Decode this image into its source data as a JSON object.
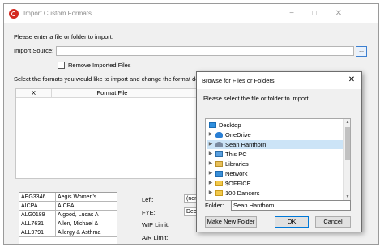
{
  "main": {
    "title": "Import Custom Formats",
    "minimize": "−",
    "maximize": "□",
    "close": "✕",
    "instruction": "Please enter a file or folder to import.",
    "source_label": "Import Source:",
    "browse_label": "...",
    "remove_label": "Remove Imported Files",
    "select_text": "Select the formats you would like to import and change the format descri",
    "table_headers": [
      "X",
      "Format File"
    ]
  },
  "clients": [
    {
      "code": "AEG3346",
      "name": "Aegis Women's"
    },
    {
      "code": "AICPA",
      "name": "AICPA"
    },
    {
      "code": "ALG0189",
      "name": "Algood, Lucas A"
    },
    {
      "code": "ALL7631",
      "name": "Allen, Michael &"
    },
    {
      "code": "ALL9791",
      "name": "Allergy & Asthma"
    }
  ],
  "fields": [
    {
      "label": "Left:",
      "value": "(non"
    },
    {
      "label": "FYE:",
      "value": "Dece"
    },
    {
      "label": "WIP Limit:",
      "value": ""
    },
    {
      "label": "A/R Limit:",
      "value": ""
    }
  ],
  "dialog": {
    "title": "Browse for Files or Folders",
    "close": "✕",
    "instruction": "Please select the file or folder to import.",
    "tree": [
      {
        "label": "Desktop",
        "icon": "desktop-icon",
        "expand": false,
        "indent": 0
      },
      {
        "label": "OneDrive",
        "icon": "onedrive-icon",
        "expand": true,
        "indent": 1
      },
      {
        "label": "Sean Hanthorn",
        "icon": "user-icon",
        "expand": true,
        "indent": 1,
        "selected": true
      },
      {
        "label": "This PC",
        "icon": "pc-icon",
        "expand": true,
        "indent": 1
      },
      {
        "label": "Libraries",
        "icon": "libraries-icon",
        "expand": true,
        "indent": 1
      },
      {
        "label": "Network",
        "icon": "network-icon",
        "expand": true,
        "indent": 1
      },
      {
        "label": "$OFFICE",
        "icon": "folder-icon",
        "expand": true,
        "indent": 1
      },
      {
        "label": "100 Dancers",
        "icon": "folder-icon",
        "expand": true,
        "indent": 1
      }
    ],
    "folder_label": "Folder:",
    "folder_value": "Sean Hanthorn",
    "make_folder": "Make New Folder",
    "ok": "OK",
    "cancel": "Cancel"
  },
  "colors": {
    "accent": "#0078d7",
    "selection": "#cce4f7",
    "app_icon": "#d42a20"
  }
}
